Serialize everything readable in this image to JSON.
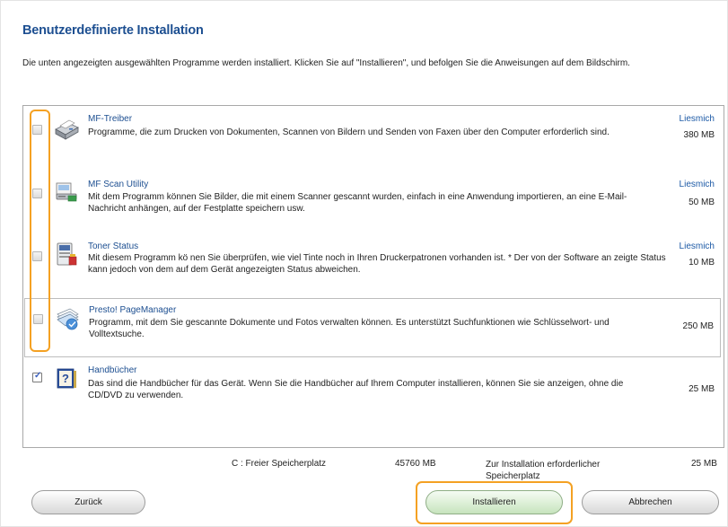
{
  "title": "Benutzerdefinierte Installation",
  "intro": "Die unten angezeigten ausgewählten Programme werden installiert. Klicken Sie auf \"Installieren\", und befolgen Sie die Anweisungen auf dem Bildschirm.",
  "programs": [
    {
      "name": "MF-Treiber",
      "description": "Programme, die zum Drucken von Dokumenten, Scannen von Bildern und Senden von Faxen über den Computer erforderlich sind.",
      "readme": "Liesmich",
      "size": "380 MB",
      "checked": false,
      "icon": "printer-icon"
    },
    {
      "name": "MF Scan Utility",
      "description": "Mit dem Programm können Sie Bilder, die mit einem Scanner gescannt wurden, einfach in eine Anwendung importieren, an eine E-Mail-Nachricht anhängen, auf der Festplatte speichern usw.",
      "readme": "Liesmich",
      "size": "50 MB",
      "checked": false,
      "icon": "scanner-icon"
    },
    {
      "name": "Toner Status",
      "description": "Mit diesem Programm kö nen Sie überprüfen, wie viel Tinte noch in Ihren Druckerpatronen vorhanden ist. * Der von der Software an zeigte Status kann jedoch von dem auf dem Gerät angezeigten Status abweichen.",
      "readme": "Liesmich",
      "size": "10 MB",
      "checked": false,
      "icon": "toner-status-icon"
    },
    {
      "name": "Presto! PageManager",
      "description": "Programm, mit dem Sie gescannte Dokumente und Fotos verwalten können. Es unterstützt Suchfunktionen wie Schlüsselwort- und Volltextsuche.",
      "readme": "",
      "size": "250 MB",
      "checked": false,
      "icon": "pagemanager-icon"
    },
    {
      "name": "Handbücher",
      "description": "Das sind die Handbücher für das Gerät. Wenn Sie die Handbücher auf Ihrem Computer installieren, können Sie sie anzeigen, ohne die CD/DVD zu verwenden.",
      "readme": "",
      "size": "25 MB",
      "checked": true,
      "icon": "manual-book-icon"
    }
  ],
  "footer": {
    "free_label": "C : Freier Speicherplatz",
    "free_value": "45760 MB",
    "required_label": "Zur Installation erforderlicher Speicherplatz",
    "required_value": "25 MB"
  },
  "buttons": {
    "back": "Zurück",
    "install": "Installieren",
    "cancel": "Abbrechen"
  },
  "colors": {
    "title": "#1d4f91",
    "link": "#1d5aa6",
    "highlight": "#f4a123"
  }
}
